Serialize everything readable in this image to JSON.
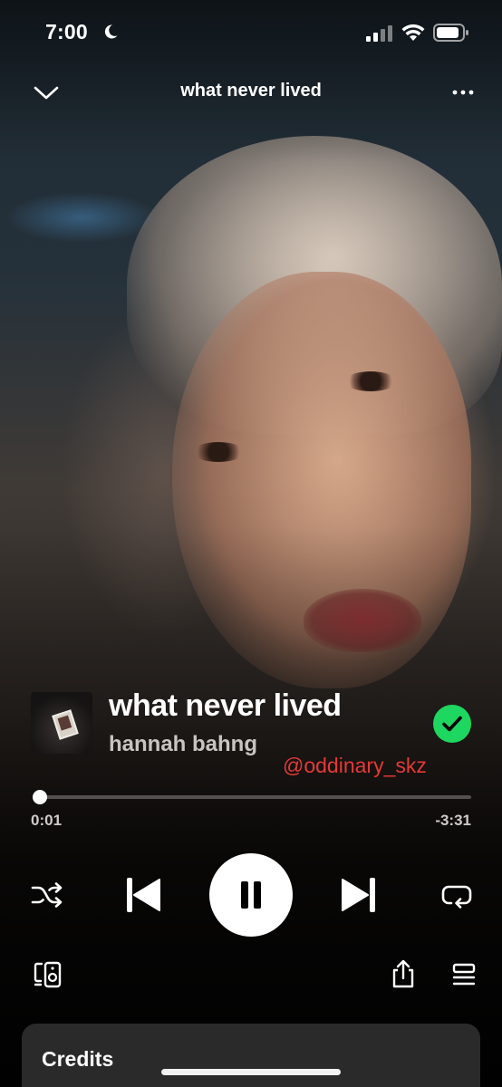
{
  "status_bar": {
    "time": "7:00",
    "icons": [
      "moon-icon",
      "signal-icon",
      "wifi-icon",
      "battery-icon"
    ]
  },
  "header": {
    "title": "what never lived",
    "left_icon": "chevron-down-icon",
    "right_icon": "more-icon"
  },
  "track": {
    "title": "what never lived",
    "artist": "hannah bahng",
    "liked": true,
    "watermark": "@oddinary_skz"
  },
  "progress": {
    "elapsed": "0:01",
    "remaining": "-3:31",
    "fraction": 0.0047
  },
  "controls": {
    "shuffle_icon": "shuffle-icon",
    "previous_icon": "skip-previous-icon",
    "play_state": "pause-icon",
    "next_icon": "skip-next-icon",
    "repeat_icon": "repeat-icon"
  },
  "bottom_row": {
    "devices_icon": "connect-device-icon",
    "share_icon": "share-icon",
    "queue_icon": "queue-icon"
  },
  "credits": {
    "title": "Credits"
  },
  "colors": {
    "accent_green": "#1ed760",
    "watermark_red": "#e53935",
    "card_bg": "#2b2a2a"
  }
}
